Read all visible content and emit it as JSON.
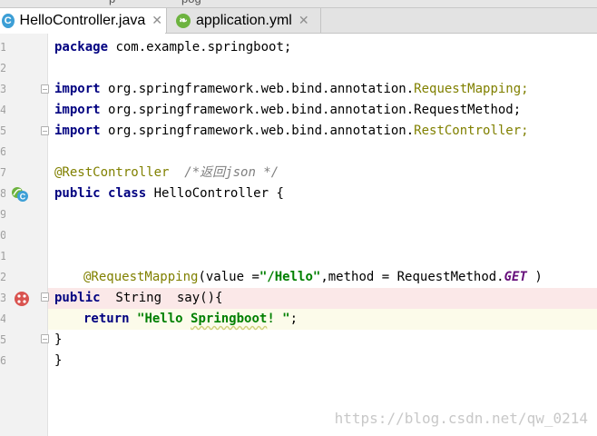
{
  "top_strip": {
    "ghost_texts": [
      "p",
      "pog"
    ]
  },
  "tabs": [
    {
      "label": "HelloController.java",
      "icon": "java-class-icon",
      "active": true
    },
    {
      "label": "application.yml",
      "icon": "spring-yml-icon",
      "active": false
    }
  ],
  "gutter": {
    "line_numbers": [
      "1",
      "2",
      "3",
      "4",
      "5",
      "6",
      "7",
      "8",
      "9",
      "0",
      "1",
      "2",
      "3",
      "4",
      "5",
      "6"
    ]
  },
  "code": {
    "l1": {
      "kw": "package",
      "rest": " com.example.springboot;"
    },
    "l3": {
      "kw": "import",
      "rest": " org.springframework.web.bind.annotation.",
      "cls": "RequestMapping",
      "end": ";"
    },
    "l4": {
      "kw": "import",
      "rest": " org.springframework.web.bind.annotation.RequestMethod;"
    },
    "l5": {
      "kw": "import",
      "rest": " org.springframework.web.bind.annotation.",
      "cls": "RestController",
      "end": ";"
    },
    "l7": {
      "ann": "@RestController",
      "cmt": "  /*返回json */"
    },
    "l8": {
      "kw1": "public",
      "kw2": "class",
      "rest": " HelloController {"
    },
    "l12": {
      "ann": "@RequestMapping",
      "a": "(value =",
      "str": "\"/Hello\"",
      "b": ",method = RequestMethod.",
      "enum": "GET",
      "c": " )"
    },
    "l13": {
      "kw": "public",
      "rest": "  String  say(){"
    },
    "l14": {
      "kw": "return",
      "str_a": "\"Hello ",
      "str_b": "Springboot",
      "str_c": "! \"",
      "end": ";"
    },
    "l15": {
      "rest": "}"
    },
    "l16": {
      "rest": "}"
    }
  },
  "watermark": "https://blog.csdn.net/qw_0214",
  "colors": {
    "keyword": "#000080",
    "annotation": "#808000",
    "string": "#008000",
    "comment": "#808080",
    "breakpoint_line": "#fbe8e8",
    "caret_line": "#fcfbea"
  }
}
